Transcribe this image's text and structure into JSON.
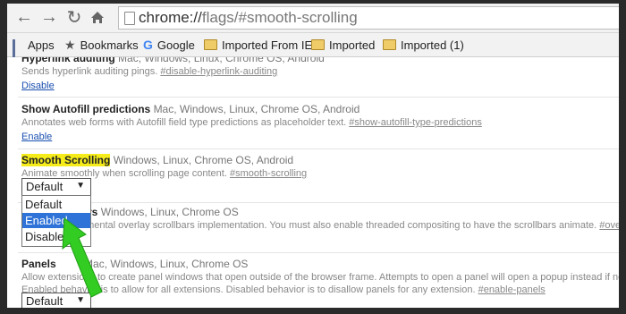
{
  "browser": {
    "url_prefix": "chrome://",
    "url_rest": "flags/#smooth-scrolling"
  },
  "bookmarks": {
    "items": [
      {
        "label": "Apps",
        "icon": "apps-grid-icon"
      },
      {
        "label": "Bookmarks",
        "icon": "star-icon"
      },
      {
        "label": "Google",
        "icon": "google-g-icon"
      },
      {
        "label": "Imported From IE",
        "icon": "folder-icon"
      },
      {
        "label": "Imported",
        "icon": "folder-icon"
      },
      {
        "label": "Imported (1)",
        "icon": "folder-icon"
      }
    ]
  },
  "flags": {
    "hyperlink": {
      "title": "Hyperlink auditing",
      "platforms": "Mac, Windows, Linux, Chrome OS, Android",
      "desc": "Sends hyperlink auditing pings.",
      "anchor": "#disable-hyperlink-auditing",
      "action": "Disable"
    },
    "autofill": {
      "title": "Show Autofill predictions",
      "platforms": "Mac, Windows, Linux, Chrome OS, Android",
      "desc": "Annotates web forms with Autofill field type predictions as placeholder text.",
      "anchor": "#show-autofill-type-predictions",
      "action": "Enable"
    },
    "smooth": {
      "title": "Smooth Scrolling",
      "platforms": "Windows, Linux, Chrome OS, Android",
      "desc": "Animate smoothly when scrolling page content.",
      "anchor": "#smooth-scrolling",
      "select_value": "Default",
      "options": [
        "Default",
        "Enabled",
        "Disabled"
      ],
      "highlighted_option": "Enabled"
    },
    "overlay": {
      "title_partial": "bars",
      "platforms": "Windows, Linux, Chrome OS",
      "desc_partial": "rimental overlay scrollbars implementation. You must also enable threaded compositing to have the scrollbars animate.",
      "anchor": "#overlay-scro"
    },
    "panels": {
      "title": "Panels",
      "platforms_partial": "Mac, Windows, Linux, Chrome OS",
      "desc1": "Allow extensions to create panel windows that open outside of the browser frame. Attempts to open a panel will open a popup instead if not enable",
      "desc2": "Enabled behavior is to allow for all extensions. Disabled behavior is to disallow panels for any extension.",
      "anchor": "#enable-panels",
      "select_value": "Default"
    }
  },
  "colors": {
    "highlight": "#f5ec1a",
    "arrow": "#33cc22",
    "selected_option": "#2f73d8",
    "link": "#1a4fb0"
  }
}
